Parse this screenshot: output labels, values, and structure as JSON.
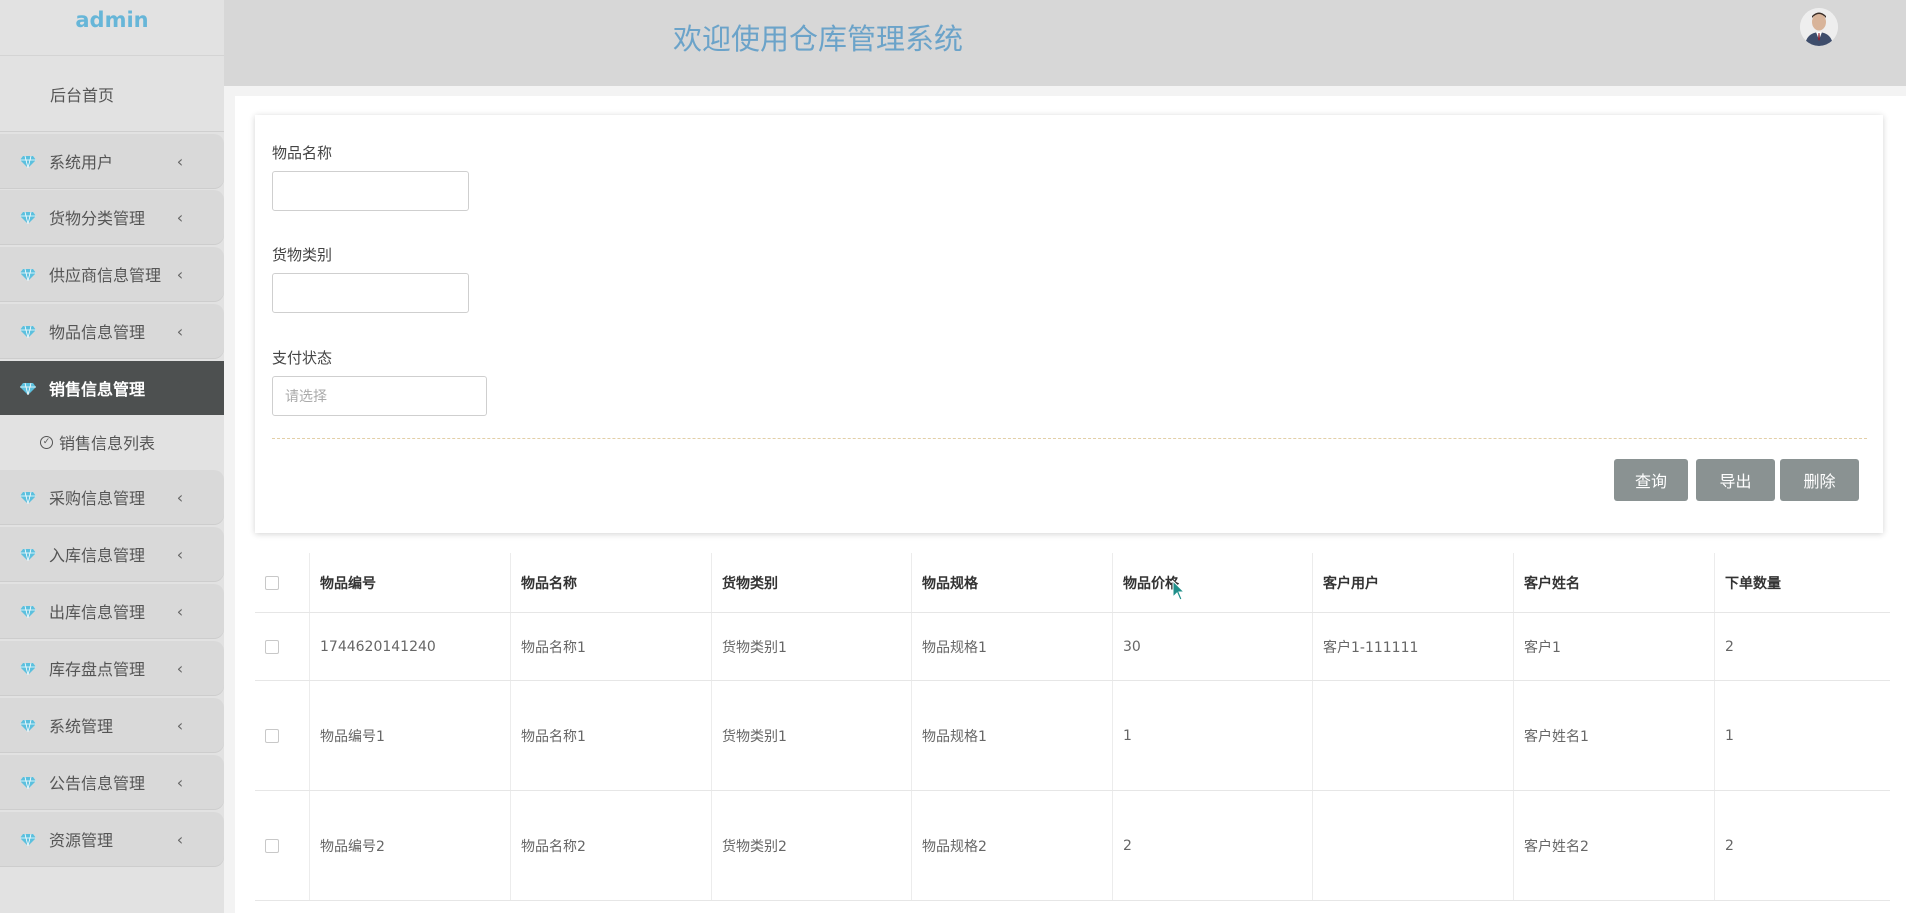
{
  "brand": "admin",
  "home_label": "后台首页",
  "menu": [
    {
      "label": "系统用户",
      "chev": "‹"
    },
    {
      "label": "货物分类管理",
      "chev": "‹"
    },
    {
      "label": "供应商信息管理",
      "chev": "‹"
    },
    {
      "label": "物品信息管理",
      "chev": "‹"
    },
    {
      "label": "销售信息管理",
      "chev": "˅"
    },
    {
      "label": "采购信息管理",
      "chev": "‹"
    },
    {
      "label": "入库信息管理",
      "chev": "‹"
    },
    {
      "label": "出库信息管理",
      "chev": "‹"
    },
    {
      "label": "库存盘点管理",
      "chev": "‹"
    },
    {
      "label": "系统管理",
      "chev": "‹"
    },
    {
      "label": "公告信息管理",
      "chev": "‹"
    },
    {
      "label": "资源管理",
      "chev": "‹"
    }
  ],
  "submenu_label": "销售信息列表",
  "header_title": "欢迎使用仓库管理系统",
  "filters": {
    "name_label": "物品名称",
    "name_value": "",
    "category_label": "货物类别",
    "category_value": "",
    "pay_label": "支付状态",
    "pay_placeholder": "请选择"
  },
  "buttons": {
    "query": "查询",
    "export": "导出",
    "delete": "删除"
  },
  "table": {
    "columns": [
      "物品编号",
      "物品名称",
      "货物类别",
      "物品规格",
      "物品价格",
      "客户用户",
      "客户姓名",
      "下单数量"
    ],
    "rows": [
      [
        "1744620141240",
        "物品名称1",
        "货物类别1",
        "物品规格1",
        "30",
        "客户1-111111",
        "客户1",
        "2"
      ],
      [
        "物品编号1",
        "物品名称1",
        "货物类别1",
        "物品规格1",
        "1",
        "",
        "客户姓名1",
        "1"
      ],
      [
        "物品编号2",
        "物品名称2",
        "货物类别2",
        "物品规格2",
        "2",
        "",
        "客户姓名2",
        "2"
      ]
    ]
  },
  "colors": {
    "accent_title": "#6ba3c9",
    "brand": "#67b6d8",
    "active_menu_bg": "#4d5050",
    "button_bg": "#8a9292",
    "gem": "#5bc0de"
  }
}
